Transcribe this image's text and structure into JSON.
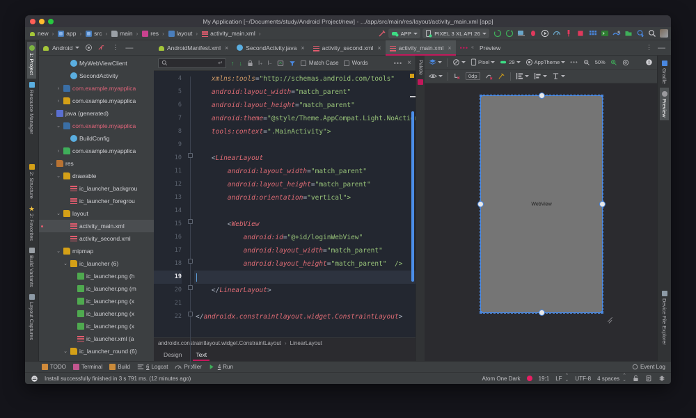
{
  "window": {
    "title": "My Application [~/Documents/study/Android Project/new] - .../app/src/main/res/layout/activity_main.xml [app]",
    "close_label": "close",
    "minimize_label": "minimize",
    "zoom_label": "zoom"
  },
  "navbar": {
    "crumbs": [
      {
        "label": "new",
        "icon": "android-project-icon"
      },
      {
        "label": "app",
        "icon": "module-icon"
      },
      {
        "label": "src",
        "icon": "module-icon"
      },
      {
        "label": "main",
        "icon": "folder-icon"
      },
      {
        "label": "res",
        "icon": "res-folder-icon"
      },
      {
        "label": "layout",
        "icon": "layout-folder-icon"
      },
      {
        "label": "activity_main.xml",
        "icon": "xml-file-icon"
      }
    ],
    "separator": "›",
    "run_config": "APP",
    "device": "PIXEL 3 XL API 26",
    "icons": [
      "make-project-icon",
      "sync-gradle-icon",
      "avd-manager-icon",
      "sdk-manager-icon",
      "run-icon",
      "debug-icon",
      "profiler-icon",
      "attach-debugger-icon",
      "stop-icon",
      "layout-inspector-icon",
      "terminal-icon",
      "logcat-icon",
      "device-explorer-icon",
      "sync-icon",
      "search-icon",
      "avatar-icon"
    ]
  },
  "left_strip": {
    "tabs": [
      {
        "label": "1: Project",
        "active": true,
        "icon": "project-icon"
      },
      {
        "label": "Resource Manager",
        "active": false,
        "icon": "resource-manager-icon"
      },
      {
        "label": "2: Structure",
        "active": false,
        "icon": "structure-icon"
      },
      {
        "label": "2: Favorites",
        "active": false,
        "icon": "favorites-icon"
      },
      {
        "label": "Build Variants",
        "active": false,
        "icon": "build-variants-icon"
      },
      {
        "label": "Layout Captures",
        "active": false,
        "icon": "layout-captures-icon"
      }
    ]
  },
  "right_strip": {
    "tabs": [
      {
        "label": "Gradle",
        "active": false,
        "icon": "gradle-icon"
      },
      {
        "label": "Preview",
        "active": true,
        "icon": "preview-icon"
      },
      {
        "label": "Device File Explorer",
        "active": false,
        "icon": "device-file-explorer-icon"
      }
    ]
  },
  "palette_strip": {
    "tabs": [
      {
        "label": "Palette",
        "icon": "palette-icon"
      }
    ]
  },
  "project_panel": {
    "title": "Android",
    "toolbar_icons": [
      "target-icon",
      "collapse-all-icon",
      "more-options-icon",
      "hide-icon"
    ],
    "tree": [
      {
        "indent": 3,
        "arrow": "",
        "icon": "class-icon",
        "label": "MyWebViewClient",
        "style": "normal"
      },
      {
        "indent": 3,
        "arrow": "",
        "icon": "class-icon",
        "label": "SecondActivity",
        "style": "normal"
      },
      {
        "indent": 2,
        "arrow": "›",
        "icon": "package-icon-blue",
        "label": "com.example.myapplica",
        "style": "red"
      },
      {
        "indent": 2,
        "arrow": "›",
        "icon": "package-icon-yellow",
        "label": "com.example.myapplica",
        "style": "normal"
      },
      {
        "indent": 1,
        "arrow": "⌄",
        "icon": "java-icon",
        "label": "java (generated)",
        "style": "normal"
      },
      {
        "indent": 2,
        "arrow": "⌄",
        "icon": "package-icon-blue",
        "label": "com.example.myapplica",
        "style": "red"
      },
      {
        "indent": 3,
        "arrow": "",
        "icon": "class-icon",
        "label": "BuildConfig",
        "style": "normal"
      },
      {
        "indent": 2,
        "arrow": "›",
        "icon": "package-icon-green",
        "label": "com.example.myapplica",
        "style": "normal"
      },
      {
        "indent": 1,
        "arrow": "⌄",
        "icon": "res-folder-icon",
        "label": "res",
        "style": "normal"
      },
      {
        "indent": 2,
        "arrow": "⌄",
        "icon": "folder-icon-yellow",
        "label": "drawable",
        "style": "normal"
      },
      {
        "indent": 3,
        "arrow": "",
        "icon": "xml-file-icon",
        "label": "ic_launcher_backgrou",
        "style": "normal"
      },
      {
        "indent": 3,
        "arrow": "",
        "icon": "xml-file-icon",
        "label": "ic_launcher_foregrou",
        "style": "normal"
      },
      {
        "indent": 2,
        "arrow": "⌄",
        "icon": "folder-icon-yellow",
        "label": "layout",
        "style": "normal"
      },
      {
        "indent": 3,
        "arrow": "",
        "icon": "xml-file-icon",
        "label": "activity_main.xml",
        "style": "normal",
        "selected": true,
        "modified": true
      },
      {
        "indent": 3,
        "arrow": "",
        "icon": "xml-file-icon",
        "label": "activity_second.xml",
        "style": "normal"
      },
      {
        "indent": 2,
        "arrow": "⌄",
        "icon": "folder-icon-yellow",
        "label": "mipmap",
        "style": "normal"
      },
      {
        "indent": 3,
        "arrow": "⌄",
        "icon": "folder-icon-yellow",
        "label": "ic_launcher (6)",
        "style": "normal"
      },
      {
        "indent": 4,
        "arrow": "",
        "icon": "png-file-icon",
        "label": "ic_launcher.png (h",
        "style": "normal"
      },
      {
        "indent": 4,
        "arrow": "",
        "icon": "png-file-icon",
        "label": "ic_launcher.png (m",
        "style": "normal"
      },
      {
        "indent": 4,
        "arrow": "",
        "icon": "png-file-icon",
        "label": "ic_launcher.png (x",
        "style": "normal"
      },
      {
        "indent": 4,
        "arrow": "",
        "icon": "png-file-icon",
        "label": "ic_launcher.png (x",
        "style": "normal"
      },
      {
        "indent": 4,
        "arrow": "",
        "icon": "png-file-icon",
        "label": "ic_launcher.png (x",
        "style": "normal"
      },
      {
        "indent": 4,
        "arrow": "",
        "icon": "xml-file-icon",
        "label": "ic_launcher.xml (a",
        "style": "normal"
      },
      {
        "indent": 3,
        "arrow": "⌄",
        "icon": "folder-icon-yellow",
        "label": "ic_launcher_round (6)",
        "style": "normal"
      }
    ]
  },
  "editor_tabs": [
    {
      "label": "AndroidManifest.xml",
      "icon": "android-manifest-icon",
      "active": false
    },
    {
      "label": "SecondActivity.java",
      "icon": "java-class-icon",
      "active": false
    },
    {
      "label": "activity_second.xml",
      "icon": "xml-file-icon",
      "active": false
    },
    {
      "label": "activity_main.xml",
      "icon": "xml-file-icon",
      "active": true
    }
  ],
  "editor_tabs_overflow": "…",
  "preview_tab_label": "Preview",
  "find_bar": {
    "placeholder": "",
    "value": "",
    "search_icon": "search-icon",
    "enter_icon": "enter-icon",
    "match_case_label": "Match Case",
    "words_label": "Words",
    "match_case_checked": false,
    "words_checked": false,
    "icons": [
      "prev-occurrence-icon",
      "next-occurrence-icon",
      "lock-icon",
      "select-all-icon",
      "add-selection-icon",
      "export-icon",
      "filter-icon",
      "more-icon",
      "close-icon"
    ]
  },
  "code": {
    "first_line": 4,
    "current_line": 19,
    "lines": [
      {
        "n": 4,
        "tokens": [
          {
            "t": "    ",
            "c": "pun"
          },
          {
            "t": "xmlns:tools",
            "c": "ns"
          },
          {
            "t": "=",
            "c": "pun"
          },
          {
            "t": "\"http://schemas.android.com/tools\"",
            "c": "val"
          }
        ]
      },
      {
        "n": 5,
        "tokens": [
          {
            "t": "    ",
            "c": "pun"
          },
          {
            "t": "android:layout_width",
            "c": "attr"
          },
          {
            "t": "=",
            "c": "pun"
          },
          {
            "t": "\"match_parent\"",
            "c": "val"
          }
        ]
      },
      {
        "n": 6,
        "tokens": [
          {
            "t": "    ",
            "c": "pun"
          },
          {
            "t": "android:layout_height",
            "c": "attr"
          },
          {
            "t": "=",
            "c": "pun"
          },
          {
            "t": "\"match_parent\"",
            "c": "val"
          }
        ]
      },
      {
        "n": 7,
        "tokens": [
          {
            "t": "    ",
            "c": "pun"
          },
          {
            "t": "android:theme",
            "c": "attr"
          },
          {
            "t": "=",
            "c": "pun"
          },
          {
            "t": "\"@style/Theme.AppCompat.Light.NoActionB",
            "c": "val"
          }
        ]
      },
      {
        "n": 8,
        "tokens": [
          {
            "t": "    ",
            "c": "pun"
          },
          {
            "t": "tools:context",
            "c": "attr"
          },
          {
            "t": "=",
            "c": "pun"
          },
          {
            "t": "\".MainActivity\">",
            "c": "val"
          }
        ]
      },
      {
        "n": 9,
        "tokens": []
      },
      {
        "n": 10,
        "tokens": [
          {
            "t": "    ",
            "c": "pun"
          },
          {
            "t": "<",
            "c": "pun"
          },
          {
            "t": "LinearLayout",
            "c": "tag"
          }
        ]
      },
      {
        "n": 11,
        "tokens": [
          {
            "t": "        ",
            "c": "pun"
          },
          {
            "t": "android:layout_width",
            "c": "attr"
          },
          {
            "t": "=",
            "c": "pun"
          },
          {
            "t": "\"match_parent\"",
            "c": "val"
          }
        ]
      },
      {
        "n": 12,
        "tokens": [
          {
            "t": "        ",
            "c": "pun"
          },
          {
            "t": "android:layout_height",
            "c": "attr"
          },
          {
            "t": "=",
            "c": "pun"
          },
          {
            "t": "\"match_parent\"",
            "c": "val"
          }
        ]
      },
      {
        "n": 13,
        "tokens": [
          {
            "t": "        ",
            "c": "pun"
          },
          {
            "t": "android:orientation",
            "c": "attr"
          },
          {
            "t": "=",
            "c": "pun"
          },
          {
            "t": "\"vertical\">",
            "c": "val"
          }
        ]
      },
      {
        "n": 14,
        "tokens": []
      },
      {
        "n": 15,
        "tokens": [
          {
            "t": "        ",
            "c": "pun"
          },
          {
            "t": "<",
            "c": "pun"
          },
          {
            "t": "WebView",
            "c": "tag"
          }
        ]
      },
      {
        "n": 16,
        "tokens": [
          {
            "t": "            ",
            "c": "pun"
          },
          {
            "t": "android:id",
            "c": "attr"
          },
          {
            "t": "=",
            "c": "pun"
          },
          {
            "t": "\"@+id/loginWebView\"",
            "c": "val"
          }
        ]
      },
      {
        "n": 17,
        "tokens": [
          {
            "t": "            ",
            "c": "pun"
          },
          {
            "t": "android:layout_width",
            "c": "attr"
          },
          {
            "t": "=",
            "c": "pun"
          },
          {
            "t": "\"match_parent\"",
            "c": "val"
          }
        ]
      },
      {
        "n": 18,
        "tokens": [
          {
            "t": "            ",
            "c": "pun"
          },
          {
            "t": "android:layout_height",
            "c": "attr"
          },
          {
            "t": "=",
            "c": "pun"
          },
          {
            "t": "\"match_parent\"  />",
            "c": "val"
          }
        ]
      },
      {
        "n": 19,
        "tokens": [],
        "caret": true
      },
      {
        "n": 20,
        "tokens": [
          {
            "t": "    ",
            "c": "pun"
          },
          {
            "t": "</",
            "c": "pun"
          },
          {
            "t": "LinearLayout",
            "c": "tag"
          },
          {
            "t": ">",
            "c": "pun"
          }
        ]
      },
      {
        "n": 21,
        "tokens": []
      },
      {
        "n": 22,
        "tokens": [
          {
            "t": "</",
            "c": "pun"
          },
          {
            "t": "androidx.constraintlayout.widget.ConstraintLayout",
            "c": "tag"
          },
          {
            "t": ">",
            "c": "pun"
          }
        ]
      }
    ]
  },
  "editor_breadcrumb": {
    "items": [
      "androidx.constraintlayout.widget.ConstraintLayout",
      "LinearLayout"
    ],
    "separator": "›"
  },
  "design_tabs": [
    {
      "label": "Design",
      "active": false
    },
    {
      "label": "Text",
      "active": true
    }
  ],
  "preview": {
    "title": "Preview",
    "header_icons": [
      "more-options-icon",
      "hide-icon"
    ],
    "toolbar_row1": {
      "design_mode": "design-surface-icon",
      "orientation": "orientation-icon",
      "device_label": "Pixel",
      "device_icon": "phone-icon",
      "api_label": "29",
      "api_icon": "api-icon",
      "theme_label": "AppTheme",
      "theme_icon": "theme-icon",
      "more": "…",
      "zoom_out_icon": "zoom-out-icon",
      "zoom_level": "50%",
      "zoom_in_icon": "zoom-in-icon",
      "zoom_fit_icon": "zoom-to-fit-icon",
      "issues_icon": "issue-notification-icon"
    },
    "toolbar_row2": {
      "visibility_icon": "eye-icon",
      "constraints_icon": "clear-constraints-icon",
      "margin_label": "0dp",
      "autoconnect_icon": "autoconnect-off-icon",
      "infer_icon": "infer-constraints-icon",
      "guidelines_icon": "guidelines-icon",
      "align_icon": "align-icon",
      "baseline_icon": "baseline-icon"
    },
    "canvas": {
      "component_label": "WebView",
      "selection_color": "#4a88e0",
      "component_fill": "#757575"
    }
  },
  "bottom_tool_window_bar": {
    "items": [
      {
        "label": "TODO",
        "icon": "todo-icon",
        "mnemonic": ""
      },
      {
        "label": "Terminal",
        "icon": "terminal-icon",
        "mnemonic": ""
      },
      {
        "label": "Build",
        "icon": "build-icon",
        "mnemonic": ""
      },
      {
        "label": "Logcat",
        "icon": "logcat-icon",
        "mnemonic": "6"
      },
      {
        "label": "Profiler",
        "icon": "profiler-icon",
        "mnemonic": ""
      },
      {
        "label": "Run",
        "icon": "run-icon",
        "mnemonic": "4"
      }
    ],
    "event_log": "Event Log",
    "event_log_icon": "event-log-icon"
  },
  "status_bar": {
    "message": "Install successfully finished in 3 s 791 ms. (12 minutes ago)",
    "message_icon": "gradle-build-icon",
    "color_scheme": "Atom One Dark",
    "color_swatch": "#e91e63",
    "caret_position": "19:1",
    "line_separator": "LF",
    "encoding": "UTF-8",
    "indent": "4 spaces",
    "right_icons": [
      "read-only-icon",
      "inspection-icon",
      "memory-icon"
    ]
  }
}
